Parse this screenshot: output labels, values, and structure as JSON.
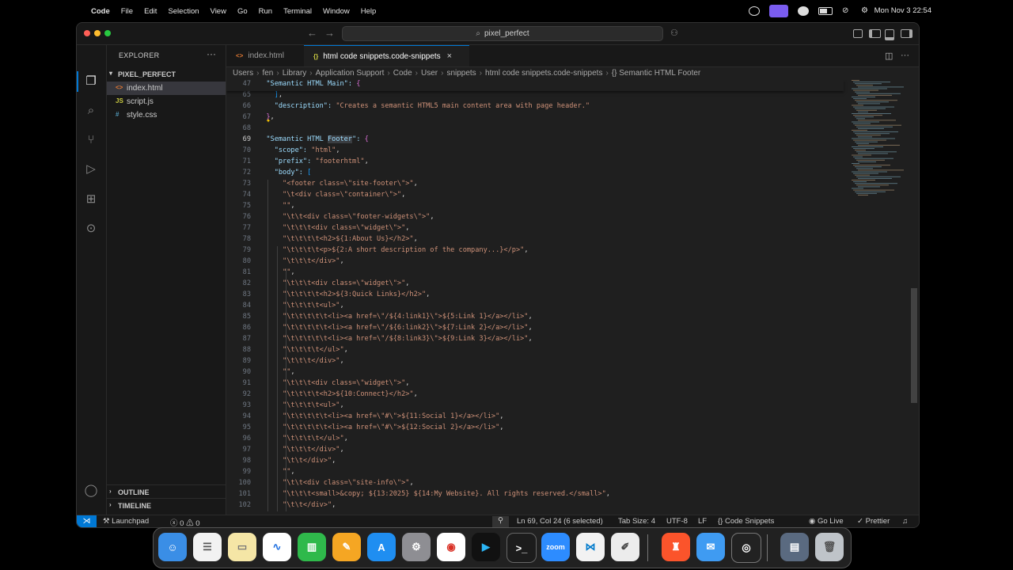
{
  "menubar": {
    "app": "Code",
    "items": [
      "File",
      "Edit",
      "Selection",
      "View",
      "Go",
      "Run",
      "Terminal",
      "Window",
      "Help"
    ],
    "clock": "Mon Nov 3  22:54"
  },
  "window": {
    "search": "pixel_perfect"
  },
  "sidebar": {
    "title": "EXPLORER",
    "folder": "PIXEL_PERFECT",
    "files": [
      {
        "icon": "<>",
        "name": "index.html"
      },
      {
        "icon": "JS",
        "name": "script.js"
      },
      {
        "icon": "#",
        "name": "style.css"
      }
    ],
    "outline": "OUTLINE",
    "timeline": "TIMELINE"
  },
  "tabs": [
    {
      "icon": "<>",
      "label": "index.html"
    },
    {
      "icon": "{}",
      "label": "html code snippets.code-snippets"
    }
  ],
  "breadcrumb": [
    "Users",
    "fen",
    "Library",
    "Application Support",
    "Code",
    "User",
    "snippets",
    "html code snippets.code-snippets",
    "{} Semantic HTML Footer"
  ],
  "editor": {
    "sticky": [
      {
        "n": "47",
        "text": "  \"Semantic HTML Main\": {"
      }
    ],
    "lines": [
      {
        "n": "65",
        "text": "    ],"
      },
      {
        "n": "66",
        "text": "    \"description\": \"Creates a semantic HTML5 main content area with page header.\""
      },
      {
        "n": "67",
        "text": "  },"
      },
      {
        "n": "68",
        "text": ""
      },
      {
        "n": "69",
        "text": "  \"Semantic HTML Footer\": {"
      },
      {
        "n": "70",
        "text": "    \"scope\": \"html\","
      },
      {
        "n": "71",
        "text": "    \"prefix\": \"footerhtml\","
      },
      {
        "n": "72",
        "text": "    \"body\": ["
      },
      {
        "n": "73",
        "text": "      \"<footer class=\\\"site-footer\\\">\","
      },
      {
        "n": "74",
        "text": "      \"\\t<div class=\\\"container\\\">\","
      },
      {
        "n": "75",
        "text": "      \"\","
      },
      {
        "n": "76",
        "text": "      \"\\t\\t<div class=\\\"footer-widgets\\\">\","
      },
      {
        "n": "77",
        "text": "      \"\\t\\t\\t<div class=\\\"widget\\\">\","
      },
      {
        "n": "78",
        "text": "      \"\\t\\t\\t\\t<h2>${1:About Us}</h2>\","
      },
      {
        "n": "79",
        "text": "      \"\\t\\t\\t\\t<p>${2:A short description of the company...}</p>\","
      },
      {
        "n": "80",
        "text": "      \"\\t\\t\\t</div>\","
      },
      {
        "n": "81",
        "text": "      \"\","
      },
      {
        "n": "82",
        "text": "      \"\\t\\t\\t<div class=\\\"widget\\\">\","
      },
      {
        "n": "83",
        "text": "      \"\\t\\t\\t\\t<h2>${3:Quick Links}</h2>\","
      },
      {
        "n": "84",
        "text": "      \"\\t\\t\\t\\t<ul>\","
      },
      {
        "n": "85",
        "text": "      \"\\t\\t\\t\\t\\t<li><a href=\\\"/${4:link1}\\\">${5:Link 1}</a></li>\","
      },
      {
        "n": "86",
        "text": "      \"\\t\\t\\t\\t\\t<li><a href=\\\"/${6:link2}\\\">${7:Link 2}</a></li>\","
      },
      {
        "n": "87",
        "text": "      \"\\t\\t\\t\\t\\t<li><a href=\\\"/${8:link3}\\\">${9:Link 3}</a></li>\","
      },
      {
        "n": "88",
        "text": "      \"\\t\\t\\t\\t</ul>\","
      },
      {
        "n": "89",
        "text": "      \"\\t\\t\\t</div>\","
      },
      {
        "n": "90",
        "text": "      \"\","
      },
      {
        "n": "91",
        "text": "      \"\\t\\t\\t<div class=\\\"widget\\\">\","
      },
      {
        "n": "92",
        "text": "      \"\\t\\t\\t\\t<h2>${10:Connect}</h2>\","
      },
      {
        "n": "93",
        "text": "      \"\\t\\t\\t\\t<ul>\","
      },
      {
        "n": "94",
        "text": "      \"\\t\\t\\t\\t\\t<li><a href=\\\"#\\\">${11:Social 1}</a></li>\","
      },
      {
        "n": "95",
        "text": "      \"\\t\\t\\t\\t\\t<li><a href=\\\"#\\\">${12:Social 2}</a></li>\","
      },
      {
        "n": "96",
        "text": "      \"\\t\\t\\t\\t</ul>\","
      },
      {
        "n": "97",
        "text": "      \"\\t\\t\\t</div>\","
      },
      {
        "n": "98",
        "text": "      \"\\t\\t</div>\","
      },
      {
        "n": "99",
        "text": "      \"\","
      },
      {
        "n": "100",
        "text": "      \"\\t\\t<div class=\\\"site-info\\\">\","
      },
      {
        "n": "101",
        "text": "      \"\\t\\t\\t<small>&copy; ${13:2025} ${14:My Website}. All rights reserved.</small>\","
      },
      {
        "n": "102",
        "text": "      \"\\t\\t</div>\","
      }
    ],
    "current_line": "69"
  },
  "statusbar": {
    "launchpad": "Launchpad",
    "errors": "0",
    "warnings": "0",
    "position": "Ln 69, Col 24 (6 selected)",
    "tabsize": "Tab Size: 4",
    "encoding": "UTF-8",
    "eol": "LF",
    "language": "Code Snippets",
    "golive": "Go Live",
    "prettier": "Prettier"
  },
  "dock": {
    "zoom_label": "zoom"
  },
  "colors": {
    "accent": "#0078d4",
    "string": "#ce9178",
    "key": "#9cdcfe"
  }
}
